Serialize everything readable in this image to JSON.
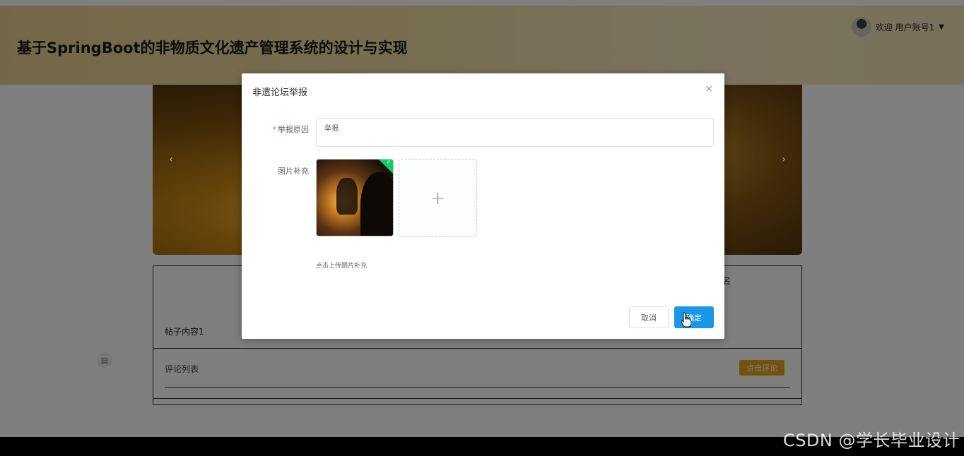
{
  "header": {
    "title": "基于SpringBoot的非物质文化遗产管理系统的设计与实现",
    "welcome_text": "欢迎 用户账号1",
    "caret": "▼"
  },
  "carousel": {
    "prev_arrow": "‹",
    "next_arrow": "›"
  },
  "post": {
    "side_text": "名",
    "content": "帖子内容1",
    "comments_title": "评论列表",
    "comment_button": "点击评论"
  },
  "dialog": {
    "title": "非遗论坛举报",
    "close_symbol": "×",
    "reason_label": "举报原因",
    "required_mark": "*",
    "reason_value": "举报",
    "image_label": "图片补充",
    "upload_plus": "+",
    "upload_tip": "点击上传图片补充",
    "cancel_label": "取消",
    "confirm_label": "确定",
    "uploaded_status_mark": "✓"
  },
  "watermark": "CSDN @学长毕业设计",
  "colors": {
    "header_gradient_start": "#e8cf8f",
    "primary_button": "#1a96e8",
    "comment_button": "#e7a619",
    "success_badge": "#13ce66",
    "required": "#f56c6c"
  },
  "icons": {
    "user_avatar": "avatar",
    "close": "close-icon",
    "upload": "plus-icon",
    "float_button": "document-icon"
  }
}
